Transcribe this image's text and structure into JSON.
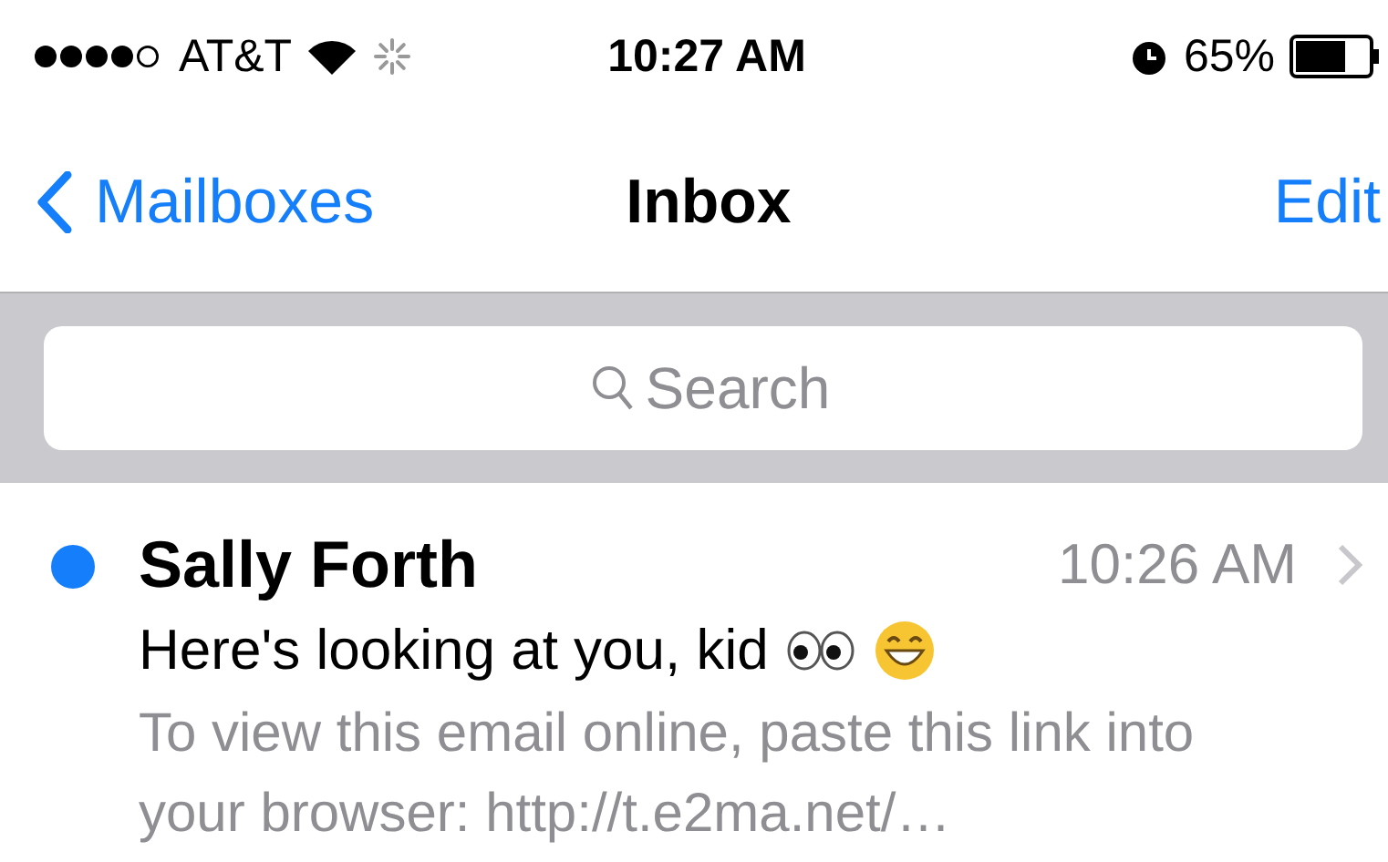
{
  "status_bar": {
    "carrier": "AT&T",
    "time": "10:27 AM",
    "battery": "65%"
  },
  "nav": {
    "back": "Mailboxes",
    "title": "Inbox",
    "action": "Edit"
  },
  "search": {
    "placeholder": "Search"
  },
  "messages": [
    {
      "sender": "Sally Forth",
      "time": "10:26 AM",
      "subject": "Here's looking at you, kid",
      "preview": "To view this email online, paste this link into your browser: http://t.e2ma.net/…",
      "unread": true
    }
  ]
}
